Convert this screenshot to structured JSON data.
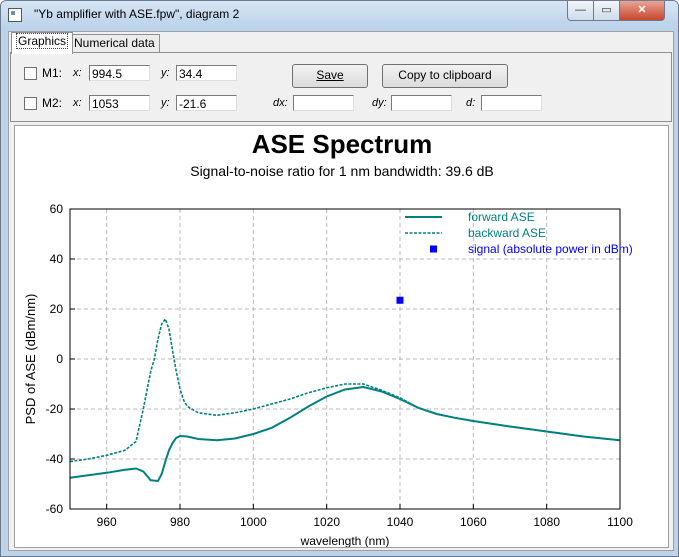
{
  "window": {
    "title": "\"Yb amplifier with ASE.fpw\", diagram 2",
    "min_glyph": "—",
    "max_glyph": "▭",
    "close_glyph": "✕"
  },
  "tabs": [
    {
      "label": "Graphics",
      "active": true
    },
    {
      "label": "Numerical data",
      "active": false
    }
  ],
  "markers": {
    "m1": {
      "label": "M1:",
      "x_label": "x:",
      "x": "994.5",
      "y_label": "y:",
      "y": "34.4",
      "checked": false
    },
    "m2": {
      "label": "M2:",
      "x_label": "x:",
      "x": "1053",
      "y_label": "y:",
      "y": "-21.6",
      "checked": false
    },
    "dx_label": "dx:",
    "dx": "",
    "dy_label": "dy:",
    "dy": "",
    "d_label": "d:",
    "d": ""
  },
  "buttons": {
    "save": "Save",
    "copy": "Copy to clipboard"
  },
  "chart_data": {
    "type": "line",
    "title": "ASE Spectrum",
    "subtitle": "Signal-to-noise ratio for 1 nm bandwidth: 39.6 dB",
    "xlabel": "wavelength (nm)",
    "ylabel": "PSD of ASE (dBm/nm)",
    "xlim": [
      950,
      1100
    ],
    "ylim": [
      -60,
      60
    ],
    "x_ticks": [
      960,
      980,
      1000,
      1020,
      1040,
      1060,
      1080,
      1100
    ],
    "y_ticks": [
      -60,
      -40,
      -20,
      0,
      20,
      40,
      60
    ],
    "grid": true,
    "legend_position": "top-right",
    "series": [
      {
        "name": "forward ASE",
        "style": "solid",
        "color": "#008080",
        "points": [
          [
            950,
            -47.5
          ],
          [
            955,
            -46.5
          ],
          [
            960,
            -45.5
          ],
          [
            965,
            -44.3
          ],
          [
            968,
            -43.8
          ],
          [
            970,
            -45
          ],
          [
            972,
            -48.5
          ],
          [
            974,
            -48.8
          ],
          [
            975,
            -46
          ],
          [
            976,
            -41
          ],
          [
            977,
            -36.5
          ],
          [
            978,
            -33.5
          ],
          [
            979,
            -31.5
          ],
          [
            980,
            -30.8
          ],
          [
            982,
            -31
          ],
          [
            985,
            -32
          ],
          [
            990,
            -32.5
          ],
          [
            995,
            -31.8
          ],
          [
            1000,
            -30
          ],
          [
            1005,
            -27.5
          ],
          [
            1010,
            -23.5
          ],
          [
            1015,
            -19
          ],
          [
            1020,
            -15
          ],
          [
            1025,
            -12.2
          ],
          [
            1030,
            -11.2
          ],
          [
            1035,
            -13
          ],
          [
            1040,
            -16
          ],
          [
            1045,
            -19.5
          ],
          [
            1050,
            -22
          ],
          [
            1055,
            -23.5
          ],
          [
            1060,
            -24.8
          ],
          [
            1070,
            -27
          ],
          [
            1080,
            -29
          ],
          [
            1090,
            -31
          ],
          [
            1100,
            -32.5
          ]
        ]
      },
      {
        "name": "backward ASE",
        "style": "dashed",
        "color": "#008080",
        "points": [
          [
            950,
            -41
          ],
          [
            955,
            -40
          ],
          [
            960,
            -38.5
          ],
          [
            965,
            -36.5
          ],
          [
            968,
            -33
          ],
          [
            970,
            -20
          ],
          [
            972,
            -5
          ],
          [
            973,
            0
          ],
          [
            974,
            8
          ],
          [
            975,
            14
          ],
          [
            976,
            16
          ],
          [
            977,
            12
          ],
          [
            978,
            3
          ],
          [
            979,
            -5
          ],
          [
            980,
            -12
          ],
          [
            981,
            -16.5
          ],
          [
            982,
            -19
          ],
          [
            985,
            -21.5
          ],
          [
            990,
            -22.5
          ],
          [
            995,
            -21.5
          ],
          [
            1000,
            -20
          ],
          [
            1005,
            -18
          ],
          [
            1010,
            -16
          ],
          [
            1015,
            -13.5
          ],
          [
            1020,
            -11.5
          ],
          [
            1025,
            -10
          ],
          [
            1030,
            -10
          ],
          [
            1035,
            -12.5
          ],
          [
            1040,
            -15.5
          ],
          [
            1045,
            -19.5
          ],
          [
            1050,
            -22
          ],
          [
            1055,
            -23.5
          ],
          [
            1060,
            -24.8
          ],
          [
            1070,
            -27
          ],
          [
            1080,
            -29
          ],
          [
            1090,
            -31
          ],
          [
            1100,
            -32.5
          ]
        ]
      },
      {
        "name": "signal (absolute power in dBm)",
        "style": "marker",
        "color": "#0000ff",
        "points": [
          [
            1040,
            23.5
          ]
        ]
      }
    ]
  }
}
